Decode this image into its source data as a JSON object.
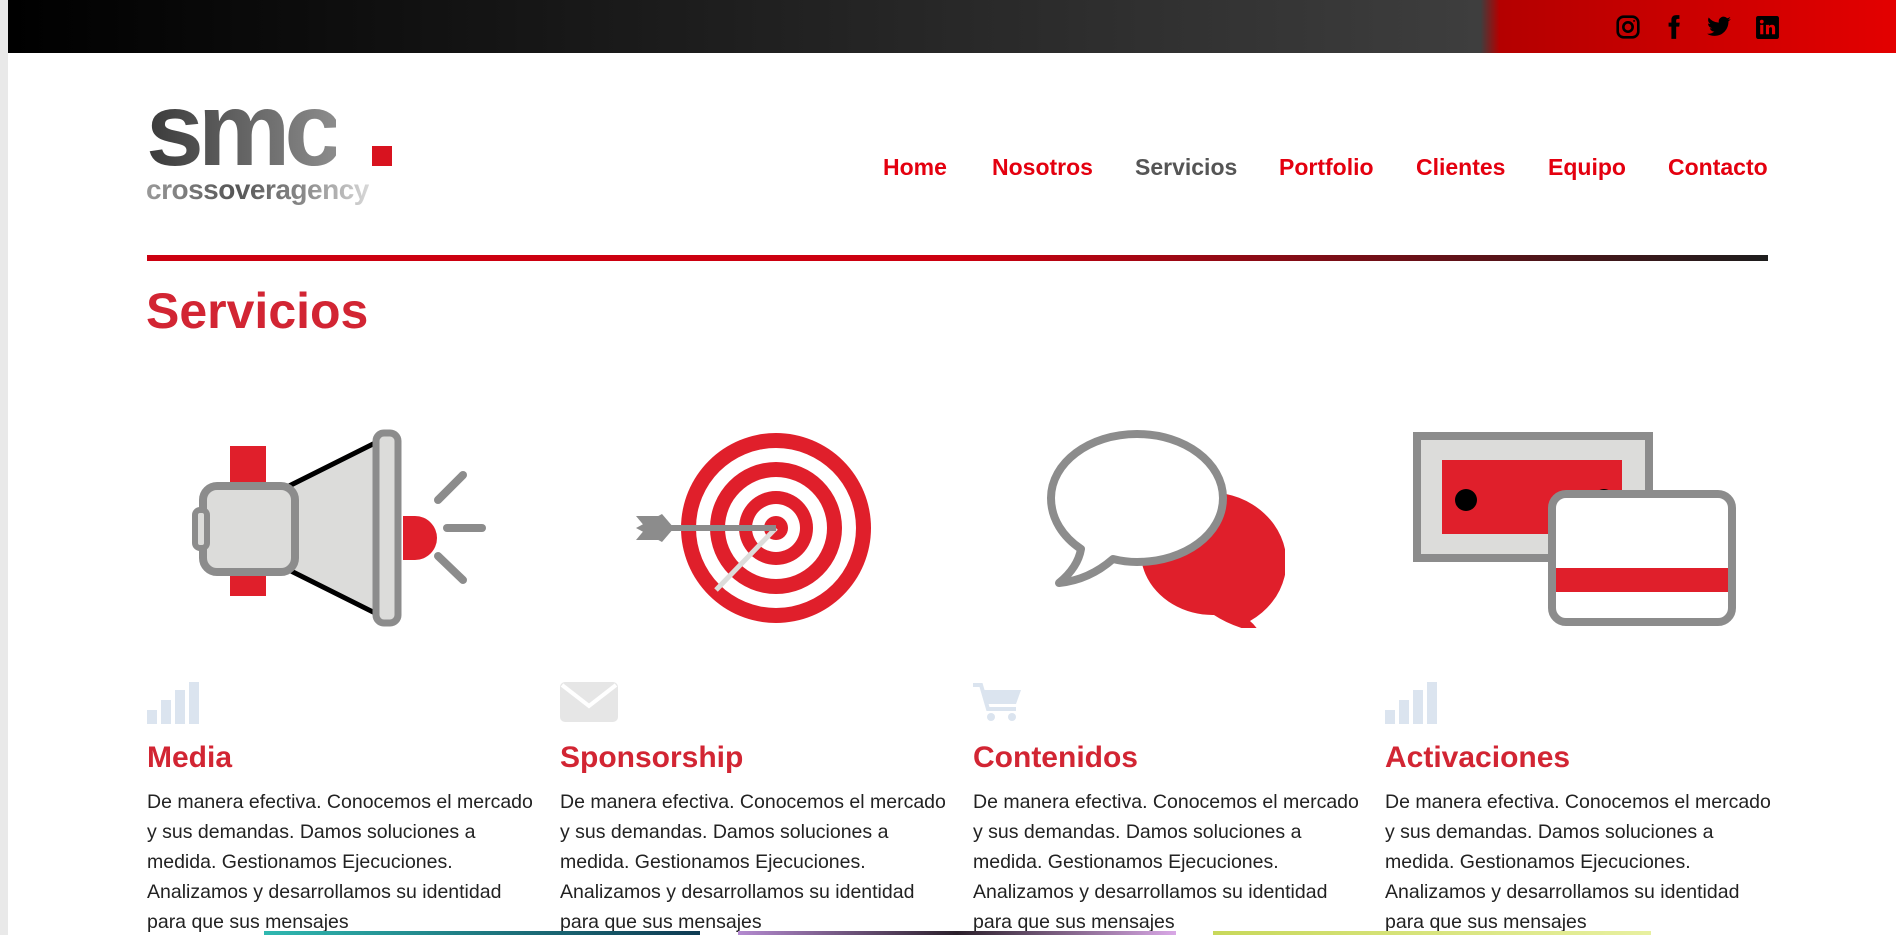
{
  "topbar": {
    "social": [
      {
        "name": "instagram-icon"
      },
      {
        "name": "facebook-icon"
      },
      {
        "name": "twitter-icon"
      },
      {
        "name": "linkedin-icon"
      }
    ]
  },
  "logo": {
    "main": "smc",
    "sub": "crossoveragency"
  },
  "nav": {
    "items": [
      "Home",
      "Nosotros",
      "Servicios",
      "Portfolio",
      "Clientes",
      "Equipo",
      "Contacto"
    ],
    "active": "Servicios"
  },
  "page": {
    "title": "Servicios"
  },
  "services": [
    {
      "title": "Media",
      "illustration": "megaphone-illustration",
      "small_icon": "bar-chart-icon",
      "description": "De manera efectiva. Conocemos el mercado y sus demandas. Damos soluciones a medida. Gestionamos Ejecuciones. Analizamos y desarrollamos su identidad para que sus mensajes"
    },
    {
      "title": "Sponsorship",
      "illustration": "target-illustration",
      "small_icon": "envelope-icon",
      "description": "De manera efectiva. Conocemos el mercado y sus demandas. Damos soluciones a medida. Gestionamos Ejecuciones. Analizamos y desarrollamos su identidad para que sus mensajes"
    },
    {
      "title": "Contenidos",
      "illustration": "speech-bubbles-illustration",
      "small_icon": "shopping-cart-icon",
      "description": "De manera efectiva. Conocemos el mercado y sus demandas. Damos soluciones a medida. Gestionamos Ejecuciones. Analizamos y desarrollamos su identidad para que sus mensajes"
    },
    {
      "title": "Activaciones",
      "illustration": "cards-illustration",
      "small_icon": "bar-chart-icon",
      "description": "De manera efectiva. Conocemos el mercado y sus demandas. Damos soluciones a medida. Gestionamos Ejecuciones. Analizamos y desarrollamos su identidad para que sus mensajes"
    }
  ],
  "colors": {
    "brand_red": "#e4000f",
    "title_red": "#d22533",
    "nav_active": "#555555",
    "icon_light_blue": "#dbe4ef"
  }
}
